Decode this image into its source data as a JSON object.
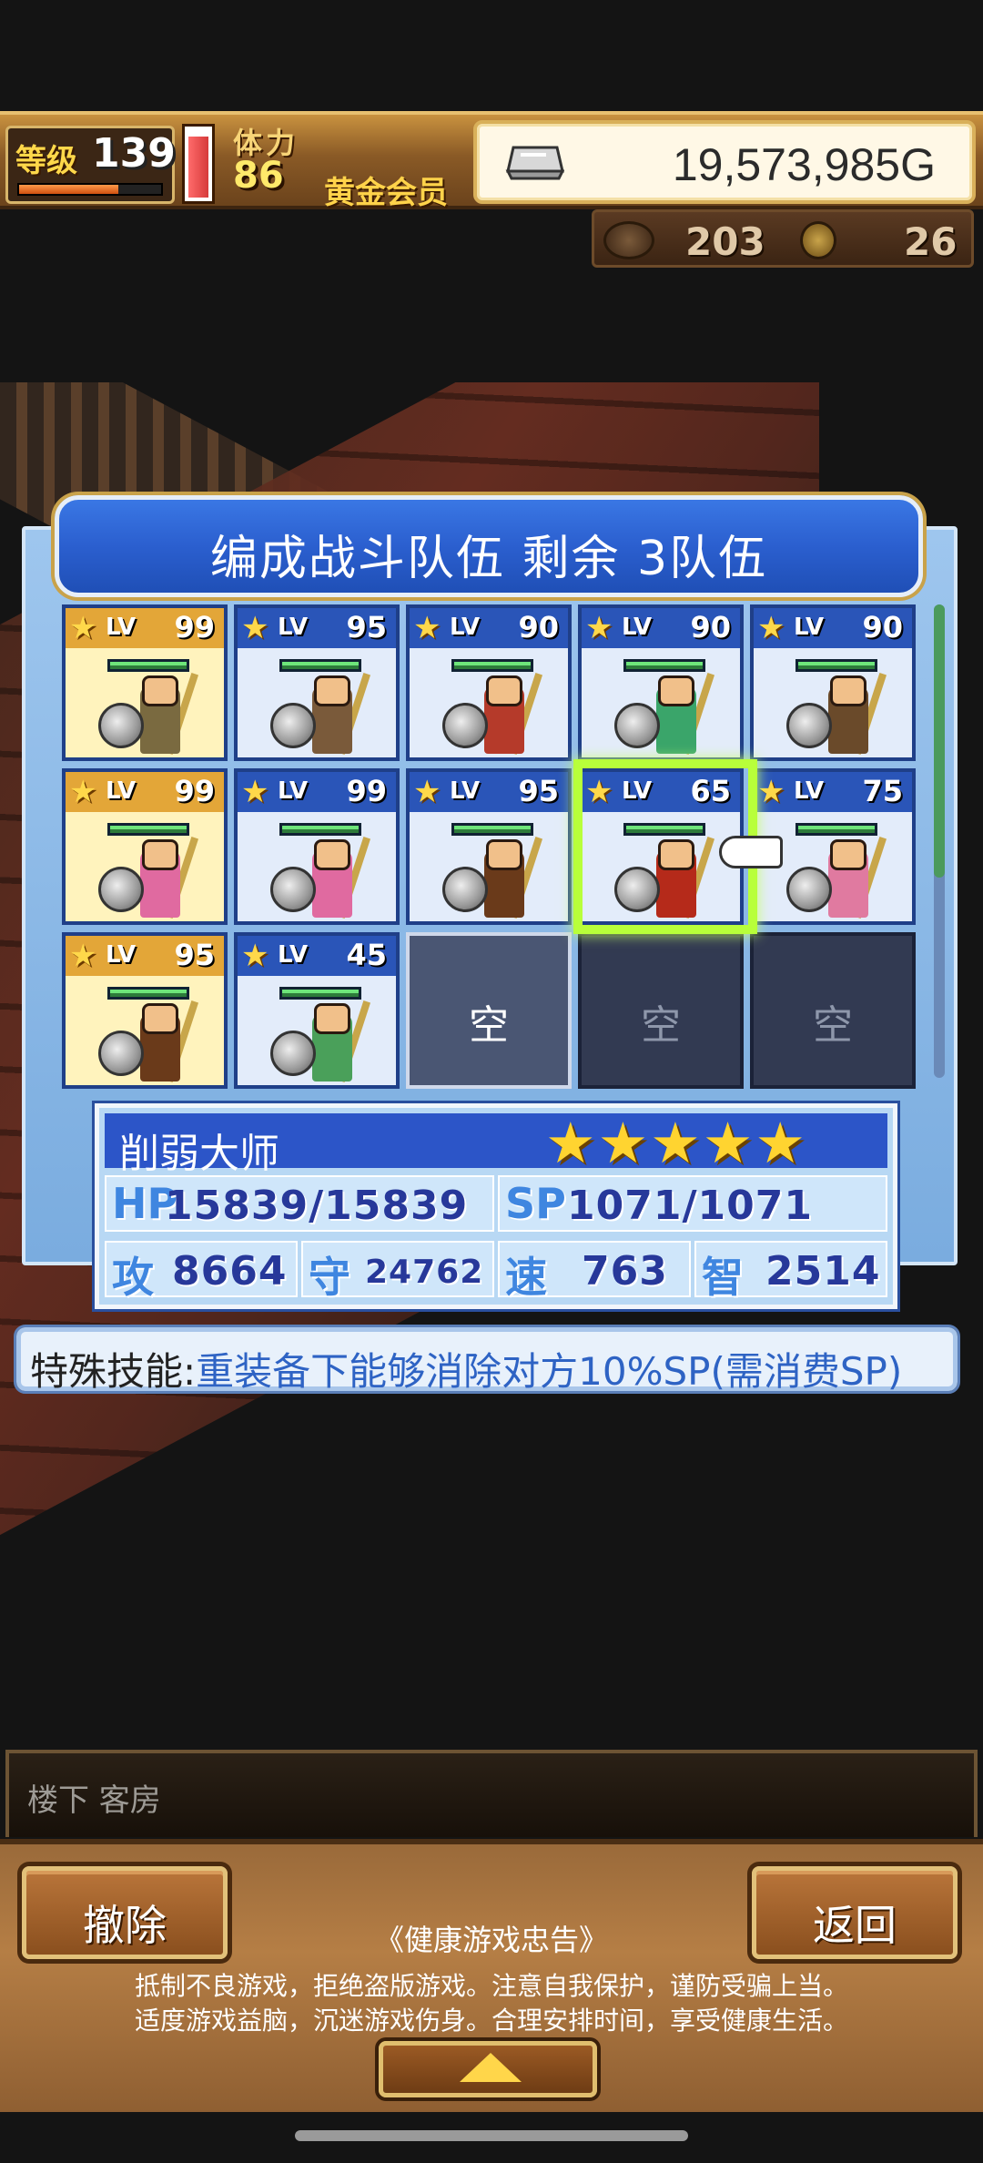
{
  "status": {
    "level_label": "等级",
    "level": "139",
    "level_progress": 0.7,
    "stamina_label": "体力",
    "stamina": "86",
    "stamina_gauge": 0.9,
    "member": "黄金会员",
    "gold": "19,573,985G",
    "resource_1": "203",
    "resource_2": "26"
  },
  "panel": {
    "title": "编成战斗队伍  剩余 3队伍"
  },
  "slots": [
    {
      "lv_label": "LV",
      "level": "99",
      "leader": true,
      "color": "#7a6a40"
    },
    {
      "lv_label": "LV",
      "level": "95",
      "leader": false,
      "color": "#7a5a3a"
    },
    {
      "lv_label": "LV",
      "level": "90",
      "leader": false,
      "color": "#b53a2a"
    },
    {
      "lv_label": "LV",
      "level": "90",
      "leader": false,
      "color": "#3aa56a"
    },
    {
      "lv_label": "LV",
      "level": "90",
      "leader": false,
      "color": "#6a4a2a"
    },
    {
      "lv_label": "LV",
      "level": "99",
      "leader": true,
      "color": "#e06aa0"
    },
    {
      "lv_label": "LV",
      "level": "99",
      "leader": false,
      "color": "#e06aa0"
    },
    {
      "lv_label": "LV",
      "level": "95",
      "leader": false,
      "color": "#6a3a1a"
    },
    {
      "lv_label": "LV",
      "level": "65",
      "leader": false,
      "color": "#b52a1a"
    },
    {
      "lv_label": "LV",
      "level": "75",
      "leader": false,
      "color": "#e07aa0"
    },
    {
      "lv_label": "LV",
      "level": "95",
      "leader": true,
      "color": "#6a3a1a"
    },
    {
      "lv_label": "LV",
      "level": "45",
      "leader": false,
      "color": "#4aa05a"
    }
  ],
  "empty_label": "空",
  "hero": {
    "name": "削弱大师",
    "stars": "★★★★★",
    "hp_key": "HP",
    "hp": "15839/15839",
    "sp_key": "SP",
    "sp": "1071/1071",
    "atk_key": "攻",
    "atk": "8664",
    "def_key": "守",
    "def": "24762",
    "spd_key": "速",
    "spd": "763",
    "int_key": "智",
    "int": "2514"
  },
  "skill": {
    "label": "特殊技能:",
    "desc": "重装备下能够消除对方10%SP(需消费SP)"
  },
  "location": "楼下 客房",
  "buttons": {
    "remove": "撤除",
    "back": "返回"
  },
  "notice": {
    "title": "《健康游戏忠告》",
    "line1": "抵制不良游戏，拒绝盗版游戏。注意自我保护，谨防受骗上当。",
    "line2": "适度游戏益脑，沉迷游戏伤身。合理安排时间，享受健康生活。"
  }
}
